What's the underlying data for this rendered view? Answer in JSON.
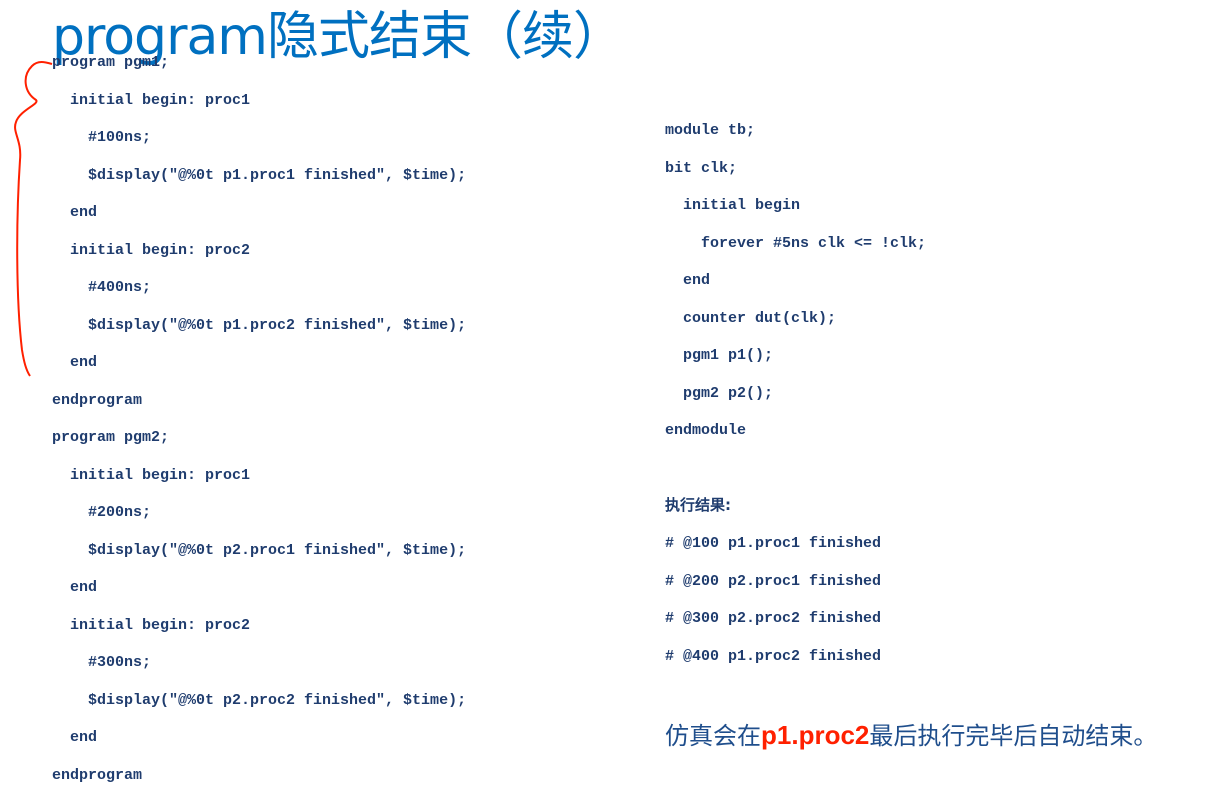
{
  "title": "program隐式结束（续）",
  "left_code": [
    "program pgm1;",
    "  initial begin: proc1",
    "    #100ns;",
    "    $display(\"@%0t p1.proc1 finished\", $time);",
    "  end",
    "  initial begin: proc2",
    "    #400ns;",
    "    $display(\"@%0t p1.proc2 finished\", $time);",
    "  end",
    "endprogram",
    "program pgm2;",
    "  initial begin: proc1",
    "    #200ns;",
    "    $display(\"@%0t p2.proc1 finished\", $time);",
    "  end",
    "  initial begin: proc2",
    "    #300ns;",
    "    $display(\"@%0t p2.proc2 finished\", $time);",
    "  end",
    "endprogram"
  ],
  "right_code": [
    "module tb;",
    "bit clk;",
    "  initial begin",
    "    forever #5ns clk <= !clk;",
    "  end",
    "  counter dut(clk);",
    "  pgm1 p1();",
    "  pgm2 p2();",
    "endmodule"
  ],
  "results_heading": "执行结果:",
  "results": [
    "# @100 p1.proc1 finished",
    "# @200 p2.proc1 finished",
    "# @300 p2.proc2 finished",
    "# @400 p1.proc2 finished"
  ],
  "conclusion": {
    "prefix": "仿真会在",
    "highlight": "p1.proc2",
    "suffix": "最后执行完毕后自动结束。"
  },
  "colors": {
    "title": "#0070c0",
    "code": "#1f3c6e",
    "highlight": "#ff2000",
    "annotation": "#ff2000"
  }
}
